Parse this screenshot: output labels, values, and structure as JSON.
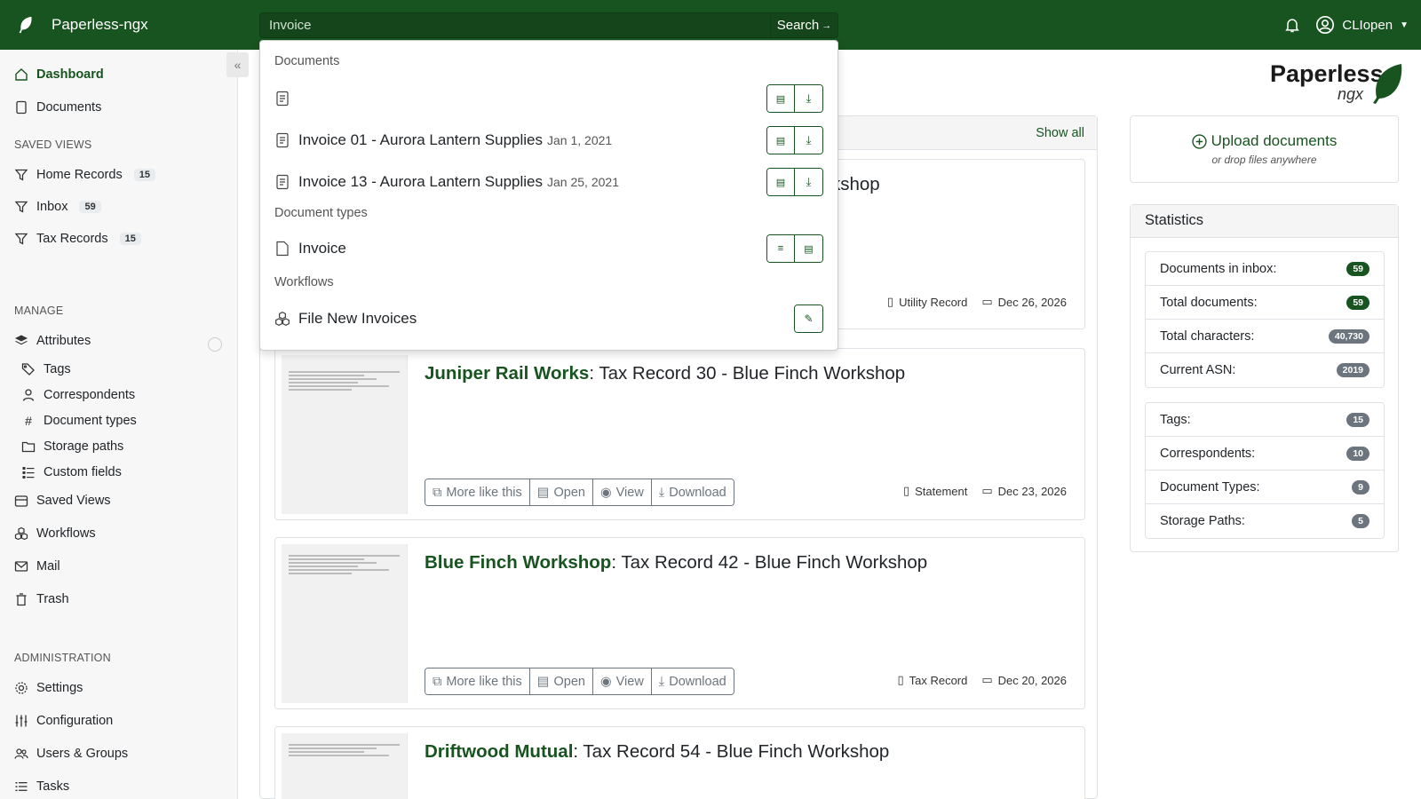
{
  "app": {
    "name": "Paperless-ngx"
  },
  "search": {
    "value": "Invoice",
    "button_label": "Search"
  },
  "user": {
    "name": "CLIopen"
  },
  "sidebar": {
    "dashboard": "Dashboard",
    "documents": "Documents",
    "saved_views_heading": "SAVED VIEWS",
    "saved_views": [
      {
        "label": "Home Records",
        "count": "15"
      },
      {
        "label": "Inbox",
        "count": "59"
      },
      {
        "label": "Tax Records",
        "count": "15"
      }
    ],
    "manage_heading": "MANAGE",
    "attributes": "Attributes",
    "attribute_items": [
      "Tags",
      "Correspondents",
      "Document types",
      "Storage paths",
      "Custom fields"
    ],
    "saved_views_item": "Saved Views",
    "workflows": "Workflows",
    "mail": "Mail",
    "trash": "Trash",
    "admin_heading": "ADMINISTRATION",
    "settings": "Settings",
    "configuration": "Configuration",
    "users_groups": "Users & Groups",
    "tasks": "Tasks"
  },
  "logo": {
    "line1": "Paperless",
    "line2": "ngx"
  },
  "panel": {
    "show_all": "Show all"
  },
  "documents": [
    {
      "correspondent": "",
      "title": "kshop",
      "type": "Utility Record",
      "date": "Dec 26, 2026"
    },
    {
      "correspondent": "Juniper Rail Works",
      "title": ": Tax Record 30 - Blue Finch Workshop",
      "type": "Statement",
      "date": "Dec 23, 2026"
    },
    {
      "correspondent": "Blue Finch Workshop",
      "title": ": Tax Record 42 - Blue Finch Workshop",
      "type": "Tax Record",
      "date": "Dec 20, 2026"
    },
    {
      "correspondent": "Driftwood Mutual",
      "title": ": Tax Record 54 - Blue Finch Workshop",
      "type": "",
      "date": ""
    }
  ],
  "doc_actions": {
    "more_like_this": "More like this",
    "open": "Open",
    "view": "View",
    "download": "Download"
  },
  "upload": {
    "title": "Upload documents",
    "subtitle": "or drop files anywhere"
  },
  "statistics": {
    "title": "Statistics",
    "group1": [
      {
        "label": "Documents in inbox:",
        "value": "59"
      },
      {
        "label": "Total documents:",
        "value": "59"
      },
      {
        "label": "Total characters:",
        "value": "40,730"
      },
      {
        "label": "Current ASN:",
        "value": "2019"
      }
    ],
    "group2": [
      {
        "label": "Tags:",
        "value": "15"
      },
      {
        "label": "Correspondents:",
        "value": "10"
      },
      {
        "label": "Document Types:",
        "value": "9"
      },
      {
        "label": "Storage Paths:",
        "value": "5"
      }
    ]
  },
  "dropdown": {
    "documents_heading": "Documents",
    "documents": [
      {
        "label": "",
        "date": ""
      },
      {
        "label": "Invoice 01 - Aurora Lantern Supplies",
        "date": "Jan 1, 2021"
      },
      {
        "label": "Invoice 13 - Aurora Lantern Supplies",
        "date": "Jan 25, 2021"
      }
    ],
    "doctypes_heading": "Document types",
    "doctypes": [
      {
        "label": "Invoice"
      }
    ],
    "workflows_heading": "Workflows",
    "workflows": [
      {
        "label": "File New Invoices"
      }
    ]
  },
  "colors": {
    "brand": "#17541f",
    "accent_green": "#17541f",
    "badge_gray": "#6c757d"
  }
}
